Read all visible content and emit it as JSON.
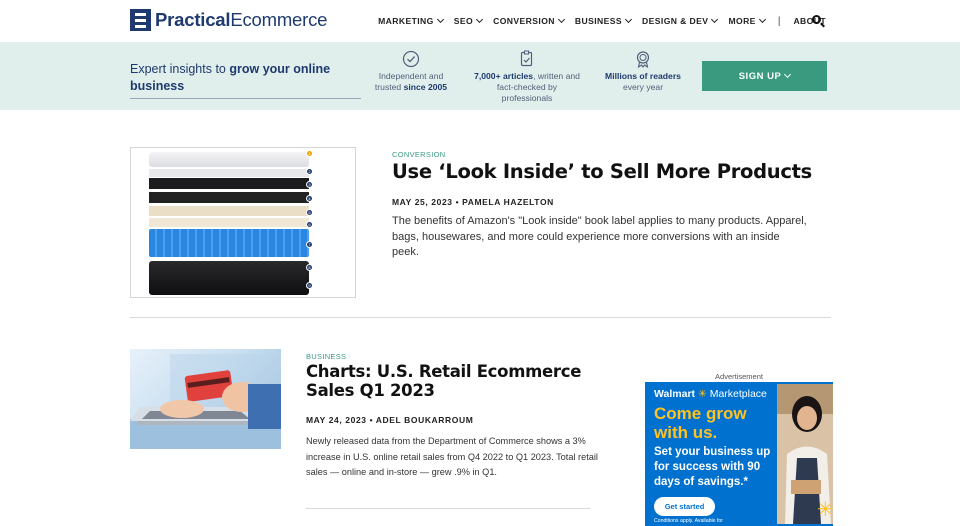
{
  "brand": {
    "logo_bold": "Practical",
    "logo_regular": "Ecommerce"
  },
  "nav": {
    "items": [
      {
        "label": "MARKETING",
        "has_dropdown": true
      },
      {
        "label": "SEO",
        "has_dropdown": true
      },
      {
        "label": "CONVERSION",
        "has_dropdown": true
      },
      {
        "label": "BUSINESS",
        "has_dropdown": true
      },
      {
        "label": "DESIGN & DEV",
        "has_dropdown": true
      },
      {
        "label": "MORE",
        "has_dropdown": true
      }
    ],
    "separator": "|",
    "about": "ABOUT",
    "search_icon": "search-icon"
  },
  "band": {
    "tagline_regular": "Expert insights to ",
    "tagline_bold": "grow your online business",
    "features": [
      {
        "icon": "check-circle-icon",
        "line1": "Independent and",
        "line2_regular": "trusted ",
        "line2_bold": "since 2005"
      },
      {
        "icon": "document-check-icon",
        "line1_bold": "7,000+ articles",
        "line1_regular": ", written and",
        "line2": "fact-checked by",
        "line3": "professionals"
      },
      {
        "icon": "award-icon",
        "line1": "Millions of readers",
        "line2": "every year"
      }
    ],
    "signup_label": "SIGN UP"
  },
  "articles": [
    {
      "category": "CONVERSION",
      "title": "Use ‘Look Inside’ to Sell More Products",
      "meta": "MAY 25, 2023 • PAMELA HAZELTON",
      "excerpt": "The benefits of Amazon's \"Look inside\" book label applies to many products. Apparel, bags, housewares, and more could experience more conversions with an inside peek.",
      "image_badges": [
        "1",
        "2",
        "3",
        "4",
        "5",
        "6",
        "7",
        "8",
        "9"
      ]
    },
    {
      "category": "BUSINESS",
      "title": "Charts: U.S. Retail Ecommerce Sales Q1 2023",
      "meta": "MAY 24, 2023 • ADEL BOUKARROUM",
      "excerpt": "Newly released data from the Department of Commerce shows a 3% increase in U.S. online retail sales from Q4 2022 to Q1 2023. Total retail sales — online and in-store — grew .9% in Q1."
    }
  ],
  "ad": {
    "label": "Advertisement",
    "brand": "Walmart",
    "brand_suffix": "Marketplace",
    "headline": "Come grow with us.",
    "subhead": "Set your business up for success with 90 days of savings.*",
    "cta": "Get started",
    "fine_print": "Conditions apply. Available for",
    "colors": {
      "background": "#0071ce",
      "accent": "#ffc220"
    }
  },
  "colors": {
    "brand_navy": "#1e3a6e",
    "accent_green": "#3a9a80",
    "band_bg": "#e0efec"
  }
}
